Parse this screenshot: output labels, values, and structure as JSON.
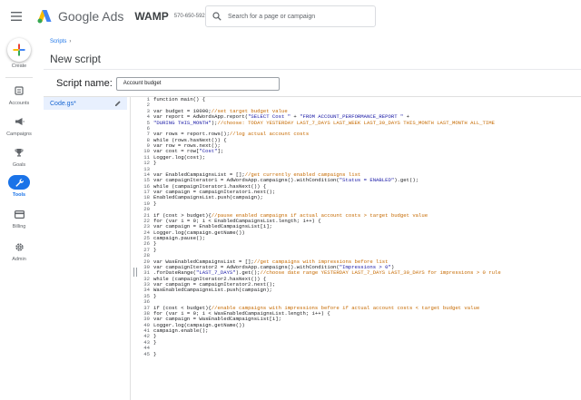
{
  "app": {
    "product_name": "Google Ads",
    "account_name": "WAMP",
    "account_id": "570-650-5923"
  },
  "search": {
    "placeholder": "Search for a page or campaign"
  },
  "rail": {
    "create_label": "Create",
    "items": [
      {
        "label": "Accounts",
        "icon": "accounts-icon"
      },
      {
        "label": "Campaigns",
        "icon": "megaphone-icon"
      },
      {
        "label": "Goals",
        "icon": "trophy-icon"
      },
      {
        "label": "Tools",
        "icon": "wrench-icon",
        "active": true
      },
      {
        "label": "Billing",
        "icon": "credit-card-icon"
      },
      {
        "label": "Admin",
        "icon": "gear-icon"
      }
    ]
  },
  "breadcrumb": {
    "label": "Scripts"
  },
  "page": {
    "title": "New script"
  },
  "script": {
    "name_label": "Script name:",
    "name_value": "Account budget",
    "file_name": "Code.gs*"
  },
  "colors": {
    "accent": "#1a73e8",
    "comment": "#c66a00",
    "string": "#1a1aa6"
  },
  "code_lines": [
    "function main() {",
    "",
    "var budget = 10000;//set target budget value",
    "var report = AdWordsApp.report(\"SELECT Cost \" + \"FROM ACCOUNT_PERFORMANCE_REPORT \" +",
    "\"DURING THIS_MONTH\");//choose: TODAY YESTERDAY LAST_7_DAYS LAST_WEEK LAST_30_DAYS THIS_MONTH LAST_MONTH ALL_TIME",
    "",
    "var rows = report.rows();//log actual account costs",
    "while (rows.hasNext()) {",
    "var row = rows.next();",
    "var cost = row[\"Cost\"];",
    "Logger.log(cost);",
    "}",
    "",
    "var EnabledCampaignsList = [];//get currently enabled campaigns list",
    "var campaignIterator1 = AdWordsApp.campaigns().withCondition(\"Status = ENABLED\").get();",
    "while (campaignIterator1.hasNext()) {",
    "var campaign = campaignIterator1.next();",
    "EnabledCampaignsList.push(campaign);",
    "}",
    "",
    "if (cost > budget){//pause enabled campaigns if actual account costs > target budget value",
    "for (var i = 0; i < EnabledCampaignsList.length; i++) {",
    "var campaign = EnabledCampaignsList[i];",
    "Logger.log(campaign.getName())",
    "campaign.pause();",
    "}",
    "}",
    "",
    "var WasEnabledCampaignsList = [];//get campaigns with impressions before list",
    "var campaignIterator2 = AdWordsApp.campaigns().withCondition(\"Impressions > 0\")",
    ".forDateRange(\"LAST_7_DAYS\").get();//choose date range YESTERDAY LAST_7_DAYS LAST_30_DAYS for impressions > 0 rule",
    "while (campaignIterator2.hasNext()) {",
    "var campaign = campaignIterator2.next();",
    "WasEnabledCampaignsList.push(campaign);",
    "}",
    "",
    "if (cost < budget){//enable campaigns with impressions before if actual account costs < target budget value",
    "for (var i = 0; i < WasEnabledCampaignsList.length; i++) {",
    "var campaign = WasEnabledCampaignsList[i];",
    "Logger.log(campaign.getName())",
    "campaign.enable();",
    "}",
    "}",
    "",
    "}"
  ]
}
